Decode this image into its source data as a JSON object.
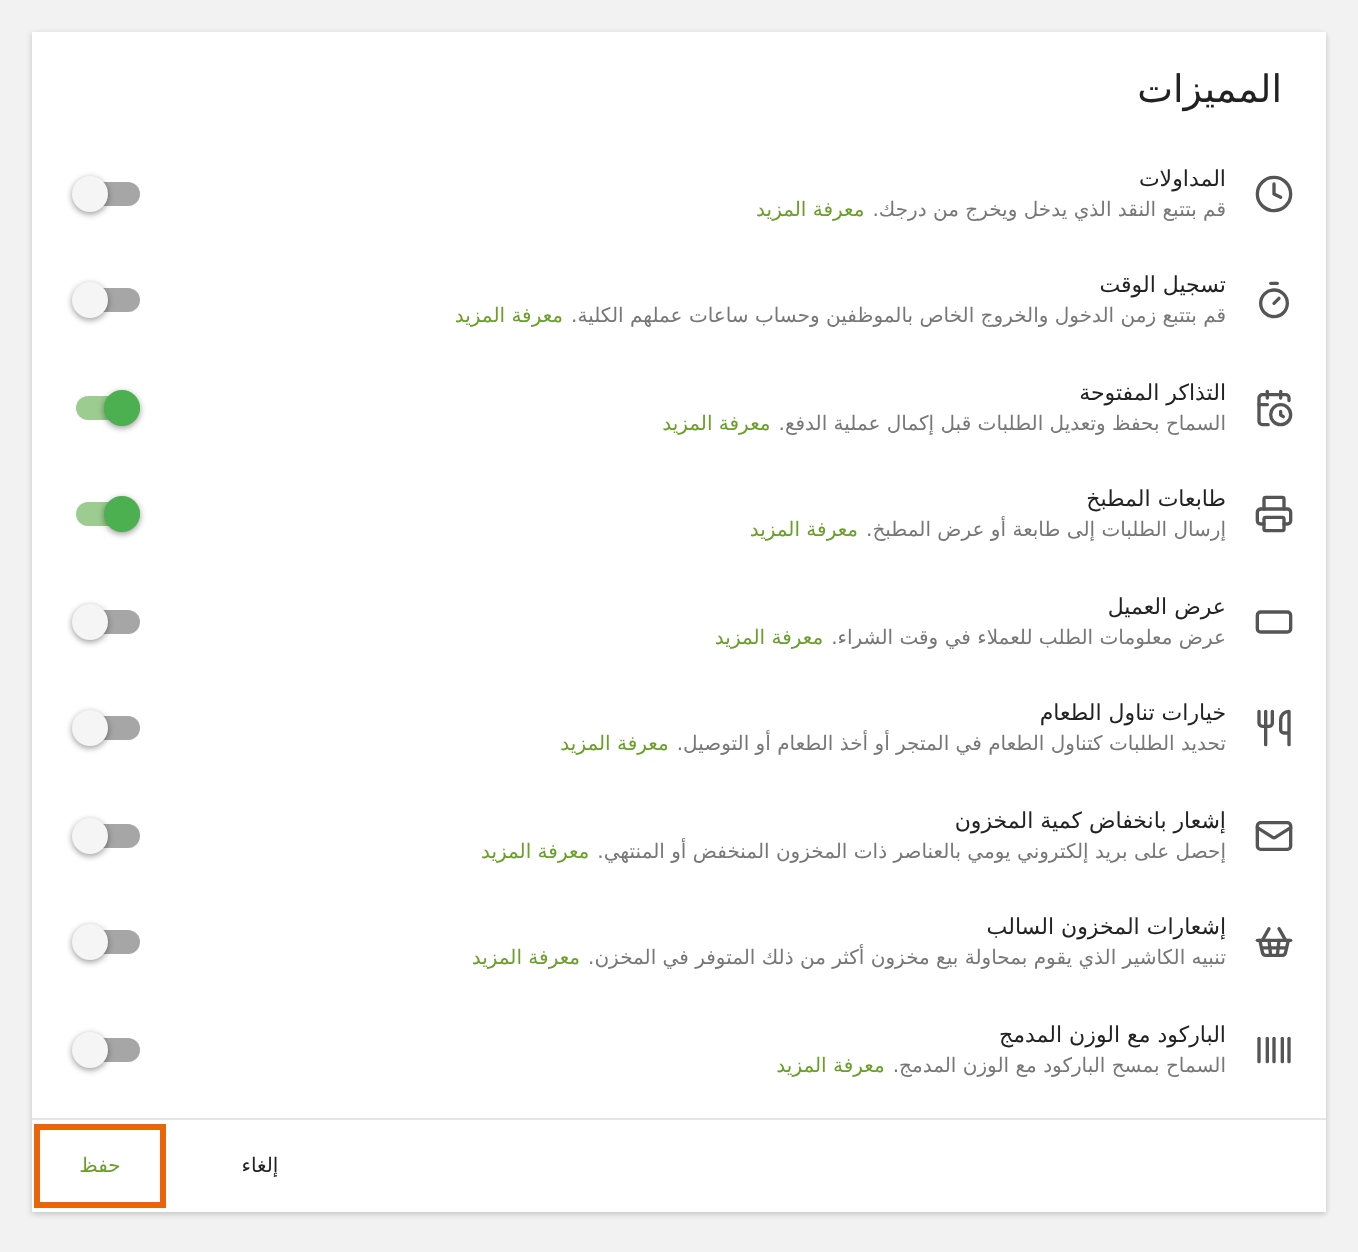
{
  "title": "المميزات",
  "features": [
    {
      "name": "المداولات",
      "description": "قم بتتبع النقد الذي يدخل ويخرج من درجك.",
      "link": "معرفة المزيد",
      "on": false
    },
    {
      "name": "تسجيل الوقت",
      "description": "قم بتتبع زمن الدخول والخروج الخاص بالموظفين وحساب ساعات عملهم الكلية.",
      "link": "معرفة المزيد",
      "on": false
    },
    {
      "name": "التذاكر المفتوحة",
      "description": "السماح بحفظ وتعديل الطلبات قبل إكمال عملية الدفع.",
      "link": "معرفة المزيد",
      "on": true
    },
    {
      "name": "طابعات المطبخ",
      "description": "إرسال الطلبات إلى طابعة أو عرض المطبخ.",
      "link": "معرفة المزيد",
      "on": true
    },
    {
      "name": "عرض العميل",
      "description": "عرض معلومات الطلب للعملاء في وقت الشراء.",
      "link": "معرفة المزيد",
      "on": false
    },
    {
      "name": "خيارات تناول الطعام",
      "description": "تحديد الطلبات كتناول الطعام في المتجر أو أخذ الطعام أو التوصيل.",
      "link": "معرفة المزيد",
      "on": false
    },
    {
      "name": "إشعار بانخفاض كمية المخزون",
      "description": "إحصل على بريد إلكتروني يومي بالعناصر ذات المخزون المنخفض أو المنتهي.",
      "link": "معرفة المزيد",
      "on": false
    },
    {
      "name": "إشعارات المخزون السالب",
      "description": "تنبيه الكاشير الذي يقوم بمحاولة بيع مخزون أكثر من ذلك المتوفر في المخزن.",
      "link": "معرفة المزيد",
      "on": false
    },
    {
      "name": "الباركود مع الوزن المدمج",
      "description": "السماح بمسح الباركود مع الوزن المدمج.",
      "link": "معرفة المزيد",
      "on": false
    }
  ],
  "buttons": [
    {
      "label": "إلغاء",
      "kind": "secondary",
      "highlighted": false
    },
    {
      "label": "حفظ",
      "kind": "primary",
      "highlighted": true
    }
  ]
}
